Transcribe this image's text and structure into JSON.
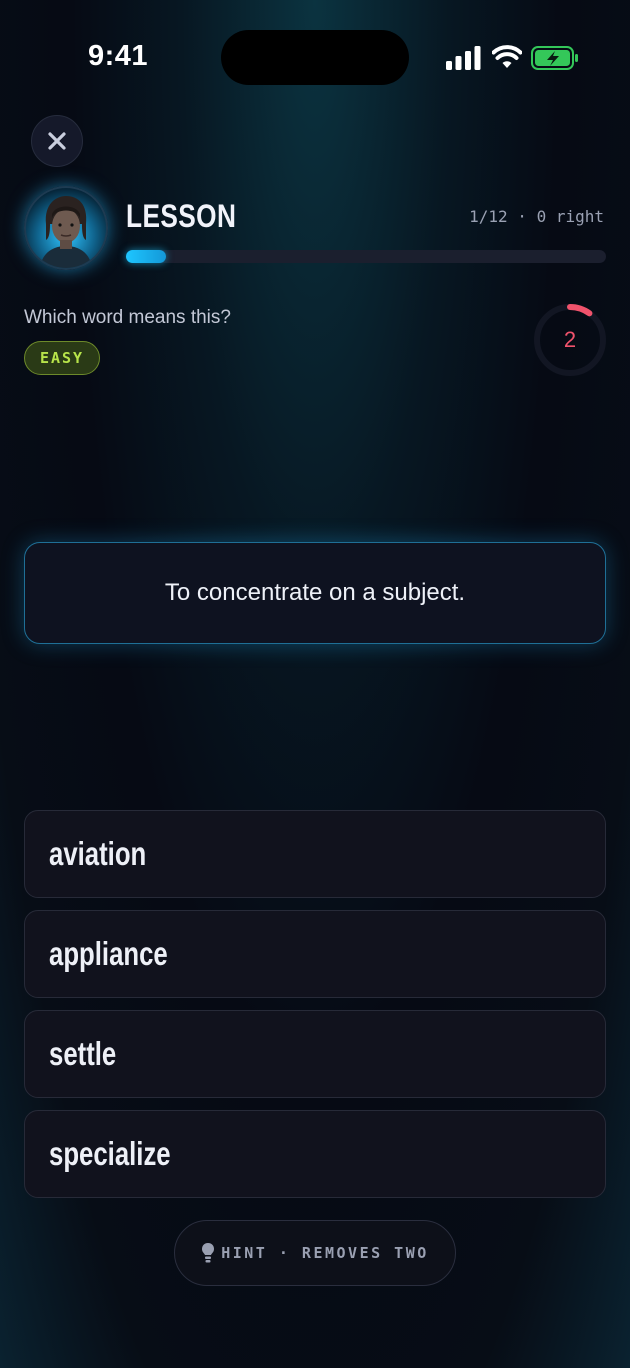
{
  "status_bar": {
    "time": "9:41"
  },
  "header": {
    "close_icon": "close-icon",
    "title": "LESSON",
    "progress_text": "1/12 · 0 right",
    "progress_value": 0.083,
    "avatar": "avatar"
  },
  "question": {
    "prompt": "Which word means this?",
    "difficulty": "EASY",
    "timer": "2",
    "timer_fraction_remaining": 0.1,
    "definition": "To concentrate on a subject."
  },
  "options": [
    "aviation",
    "appliance",
    "settle",
    "specialize"
  ],
  "hint": {
    "label": "HINT · REMOVES TWO",
    "icon": "lightbulb-icon"
  },
  "colors": {
    "accent": "#1ec6ff",
    "timer": "#f0536c",
    "easy": "#b7e34a",
    "battery": "#34c759"
  }
}
